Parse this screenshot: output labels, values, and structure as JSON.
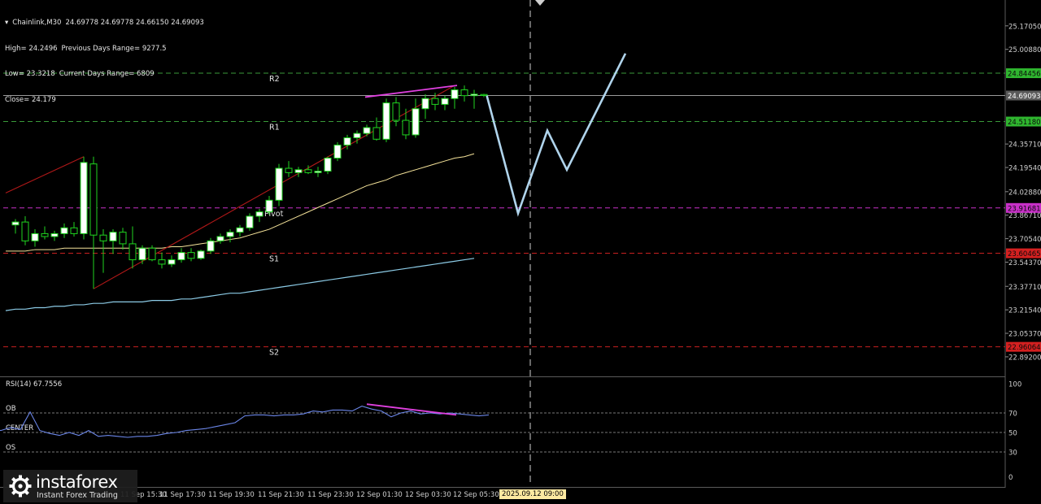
{
  "header": {
    "symbol": "Chainlink,M30",
    "ohlc": "24.69778 24.69778 24.66150 24.69093",
    "high": "High= 24.2496",
    "prev_range": "Previous Days Range= 9277.5",
    "low": "Low= 23.3218",
    "cur_range": "Current Days Range= 6809",
    "close": "Close= 24.179"
  },
  "rsi_panel": {
    "label": "RSI(14) 67.7556",
    "levels": [
      {
        "name": "OB",
        "value": 70
      },
      {
        "name": "CENTER",
        "value": 50
      },
      {
        "name": "OS",
        "value": 30
      }
    ],
    "scale_ticks": [
      "100",
      "70",
      "50",
      "30",
      "0"
    ]
  },
  "time_badge": "2025.09.12 09:00",
  "logo": {
    "name": "instaforex",
    "tagline": "Instant Forex Trading"
  },
  "colors": {
    "background": "#000000",
    "bull_candle": "#ffffff",
    "bear_candle": "#000000",
    "candle_outline": "#1fd51f",
    "pivot_dash": "#c830c8",
    "resistance_dash": "#3a9a3a",
    "support_dash": "#c82020",
    "ma_fast": "#f5e39a",
    "ma_slow": "#8ccbe6",
    "trendline": "#b01818",
    "divergence": "#e040e0",
    "forecast": "#b0d4ec",
    "rsi_line": "#6b86e8"
  },
  "chart_data": {
    "type": "candlestick",
    "symbol": "Chainlink",
    "timeframe": "M30",
    "y_axis_ticks": [
      "25.17050",
      "25.00880",
      "24.35710",
      "24.19540",
      "24.02880",
      "23.86710",
      "23.70540",
      "23.54370",
      "23.37710",
      "23.21540",
      "23.05370",
      "22.89200"
    ],
    "price_tags": [
      {
        "value": "24.84456",
        "color": "#2fb62f"
      },
      {
        "value": "24.69093",
        "color": "#5a5a5a"
      },
      {
        "value": "24.51180",
        "color": "#2fb62f"
      },
      {
        "value": "23.91681",
        "color": "#c830c8"
      },
      {
        "value": "23.60465",
        "color": "#d42020"
      },
      {
        "value": "22.96064",
        "color": "#d42020"
      }
    ],
    "pivot_levels": [
      {
        "label": "R2",
        "value": 24.845
      },
      {
        "label": "R1",
        "value": 24.512
      },
      {
        "label": "Pivot",
        "value": 23.917
      },
      {
        "label": "S1",
        "value": 23.605
      },
      {
        "label": "S2",
        "value": 22.961
      }
    ],
    "current_price": 24.69093,
    "x_labels": [
      "11 Sep 15:30",
      "11 Sep 17:30",
      "11 Sep 19:30",
      "11 Sep 21:30",
      "11 Sep 23:30",
      "12 Sep 01:30",
      "12 Sep 03:30",
      "12 Sep 05:30"
    ],
    "candles": [
      {
        "o": 23.8,
        "h": 23.84,
        "l": 23.74,
        "c": 23.82
      },
      {
        "o": 23.82,
        "h": 23.86,
        "l": 23.66,
        "c": 23.69
      },
      {
        "o": 23.69,
        "h": 23.77,
        "l": 23.65,
        "c": 23.74
      },
      {
        "o": 23.74,
        "h": 23.79,
        "l": 23.7,
        "c": 23.72
      },
      {
        "o": 23.72,
        "h": 23.76,
        "l": 23.69,
        "c": 23.74
      },
      {
        "o": 23.74,
        "h": 23.81,
        "l": 23.71,
        "c": 23.78
      },
      {
        "o": 23.78,
        "h": 23.82,
        "l": 23.72,
        "c": 23.74
      },
      {
        "o": 23.74,
        "h": 24.27,
        "l": 23.7,
        "c": 24.23
      },
      {
        "o": 24.22,
        "h": 24.27,
        "l": 23.36,
        "c": 23.73
      },
      {
        "o": 23.73,
        "h": 23.77,
        "l": 23.47,
        "c": 23.69
      },
      {
        "o": 23.69,
        "h": 23.77,
        "l": 23.6,
        "c": 23.75
      },
      {
        "o": 23.75,
        "h": 23.78,
        "l": 23.63,
        "c": 23.67
      },
      {
        "o": 23.67,
        "h": 23.79,
        "l": 23.5,
        "c": 23.56
      },
      {
        "o": 23.56,
        "h": 23.66,
        "l": 23.53,
        "c": 23.64
      },
      {
        "o": 23.64,
        "h": 23.66,
        "l": 23.55,
        "c": 23.56
      },
      {
        "o": 23.56,
        "h": 23.61,
        "l": 23.5,
        "c": 23.53
      },
      {
        "o": 23.53,
        "h": 23.59,
        "l": 23.51,
        "c": 23.56
      },
      {
        "o": 23.56,
        "h": 23.64,
        "l": 23.54,
        "c": 23.61
      },
      {
        "o": 23.61,
        "h": 23.64,
        "l": 23.55,
        "c": 23.57
      },
      {
        "o": 23.57,
        "h": 23.63,
        "l": 23.56,
        "c": 23.62
      },
      {
        "o": 23.62,
        "h": 23.71,
        "l": 23.6,
        "c": 23.69
      },
      {
        "o": 23.69,
        "h": 23.74,
        "l": 23.67,
        "c": 23.72
      },
      {
        "o": 23.72,
        "h": 23.77,
        "l": 23.68,
        "c": 23.75
      },
      {
        "o": 23.75,
        "h": 23.8,
        "l": 23.72,
        "c": 23.78
      },
      {
        "o": 23.78,
        "h": 23.88,
        "l": 23.76,
        "c": 23.86
      },
      {
        "o": 23.86,
        "h": 23.91,
        "l": 23.82,
        "c": 23.89
      },
      {
        "o": 23.89,
        "h": 24.0,
        "l": 23.87,
        "c": 23.97
      },
      {
        "o": 23.97,
        "h": 24.22,
        "l": 23.93,
        "c": 24.19
      },
      {
        "o": 24.19,
        "h": 24.24,
        "l": 24.13,
        "c": 24.16
      },
      {
        "o": 24.16,
        "h": 24.2,
        "l": 24.13,
        "c": 24.18
      },
      {
        "o": 24.18,
        "h": 24.21,
        "l": 24.15,
        "c": 24.16
      },
      {
        "o": 24.16,
        "h": 24.2,
        "l": 24.13,
        "c": 24.17
      },
      {
        "o": 24.17,
        "h": 24.27,
        "l": 24.15,
        "c": 24.26
      },
      {
        "o": 24.26,
        "h": 24.37,
        "l": 24.24,
        "c": 24.35
      },
      {
        "o": 24.35,
        "h": 24.42,
        "l": 24.32,
        "c": 24.4
      },
      {
        "o": 24.4,
        "h": 24.45,
        "l": 24.36,
        "c": 24.43
      },
      {
        "o": 24.43,
        "h": 24.49,
        "l": 24.41,
        "c": 24.47
      },
      {
        "o": 24.47,
        "h": 24.54,
        "l": 24.38,
        "c": 24.39
      },
      {
        "o": 24.39,
        "h": 24.67,
        "l": 24.37,
        "c": 24.64
      },
      {
        "o": 24.64,
        "h": 24.68,
        "l": 24.48,
        "c": 24.52
      },
      {
        "o": 24.52,
        "h": 24.6,
        "l": 24.39,
        "c": 24.42
      },
      {
        "o": 24.42,
        "h": 24.67,
        "l": 24.4,
        "c": 24.6
      },
      {
        "o": 24.6,
        "h": 24.7,
        "l": 24.53,
        "c": 24.67
      },
      {
        "o": 24.67,
        "h": 24.71,
        "l": 24.59,
        "c": 24.63
      },
      {
        "o": 24.63,
        "h": 24.69,
        "l": 24.59,
        "c": 24.67
      },
      {
        "o": 24.67,
        "h": 24.75,
        "l": 24.6,
        "c": 24.73
      },
      {
        "o": 24.73,
        "h": 24.76,
        "l": 24.65,
        "c": 24.69
      },
      {
        "o": 24.69,
        "h": 24.73,
        "l": 24.6,
        "c": 24.7
      },
      {
        "o": 24.698,
        "h": 24.703,
        "l": 24.68,
        "c": 24.691
      }
    ],
    "ma_fast": [
      23.62,
      23.62,
      23.62,
      23.63,
      23.63,
      23.63,
      23.64,
      23.64,
      23.64,
      23.64,
      23.64,
      23.64,
      23.64,
      23.64,
      23.64,
      23.64,
      23.64,
      23.65,
      23.65,
      23.66,
      23.67,
      23.68,
      23.69,
      23.7,
      23.71,
      23.73,
      23.75,
      23.77,
      23.8,
      23.83,
      23.86,
      23.89,
      23.92,
      23.95,
      23.98,
      24.01,
      24.04,
      24.07,
      24.09,
      24.11,
      24.14,
      24.16,
      24.18,
      24.2,
      24.22,
      24.24,
      24.26,
      24.27,
      24.29
    ],
    "ma_slow": [
      23.21,
      23.22,
      23.22,
      23.23,
      23.23,
      23.24,
      23.24,
      23.25,
      23.25,
      23.26,
      23.26,
      23.27,
      23.27,
      23.27,
      23.27,
      23.28,
      23.28,
      23.28,
      23.29,
      23.29,
      23.3,
      23.31,
      23.32,
      23.33,
      23.33,
      23.34,
      23.35,
      23.36,
      23.37,
      23.38,
      23.39,
      23.4,
      23.41,
      23.42,
      23.43,
      23.44,
      23.45,
      23.46,
      23.47,
      23.48,
      23.49,
      23.5,
      23.51,
      23.52,
      23.53,
      23.54,
      23.55,
      23.56,
      23.57
    ],
    "trendlines": [
      {
        "from": {
          "bar": -1,
          "price": 24.02
        },
        "to": {
          "bar": 7,
          "price": 24.27
        }
      },
      {
        "from": {
          "bar": 8,
          "price": 23.36
        },
        "to": {
          "bar": 45,
          "price": 24.76
        }
      }
    ],
    "divergence_price": {
      "from": {
        "bar": 36,
        "price": 24.68
      },
      "to": {
        "bar": 45,
        "price": 24.76
      }
    },
    "forecast_path": [
      {
        "bar": 48.3,
        "price": 24.69
      },
      {
        "bar": 51.5,
        "price": 23.88
      },
      {
        "bar": 54.5,
        "price": 24.45
      },
      {
        "bar": 56.5,
        "price": 24.18
      },
      {
        "bar": 62.5,
        "price": 24.98
      }
    ],
    "rsi": [
      51,
      52,
      50,
      50,
      51,
      52,
      50,
      54,
      52,
      55,
      53,
      71,
      52,
      49,
      47,
      50,
      47,
      52,
      46,
      47,
      46,
      45,
      46,
      46,
      47,
      49,
      50,
      52,
      53,
      54,
      56,
      58,
      60,
      67,
      68,
      68,
      67,
      68,
      68,
      69,
      72,
      71,
      73,
      73,
      72,
      77,
      74,
      72,
      66,
      70,
      72,
      69,
      70,
      69,
      70,
      69,
      68,
      67,
      68
    ],
    "rsi_divergence": {
      "from": {
        "bar": 36,
        "value": 79
      },
      "to": {
        "bar": 45,
        "value": 68
      }
    }
  }
}
